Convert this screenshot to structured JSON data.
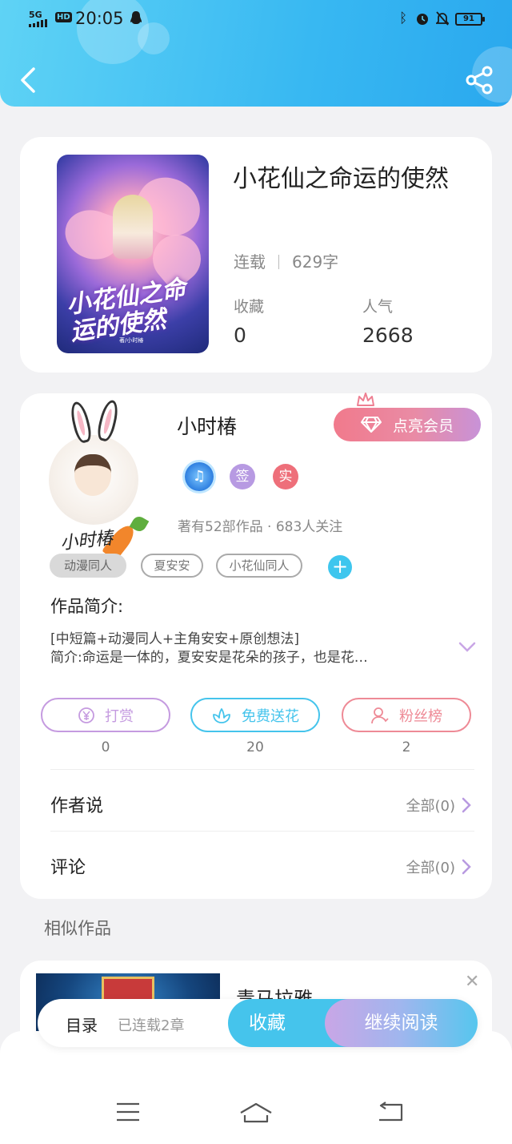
{
  "status_bar": {
    "network": "5G",
    "hd": "HD",
    "time": "20:05",
    "battery": "91"
  },
  "icons": {
    "back": "chevron-left-icon",
    "share": "share-icon"
  },
  "book": {
    "title": "小花仙之命运的使然",
    "status": "连载",
    "word_count": "629字",
    "favorites_label": "收藏",
    "favorites_value": "0",
    "popularity_label": "人气",
    "popularity_value": "2668",
    "cover_title": "小花仙之命运的使然",
    "cover_author": "著/小时椿"
  },
  "author": {
    "name": "小时椿",
    "vip_label": "点亮会员",
    "badges": [
      "签",
      "实"
    ],
    "works_info": "著有52部作品 · 683人关注",
    "signature": "小时椿"
  },
  "tags": [
    "动漫同人",
    "夏安安",
    "小花仙同人"
  ],
  "intro": {
    "label": "作品简介:",
    "line1": "[中短篇+动漫同人+主角安安+原创想法]",
    "line2": "简介:命运是一体的，夏安安是花朵的孩子，也是花…"
  },
  "actions": [
    {
      "label": "打赏",
      "count": "0",
      "color": "#c59be0"
    },
    {
      "label": "免费送花",
      "count": "20",
      "color": "#45c4ec"
    },
    {
      "label": "粉丝榜",
      "count": "2",
      "color": "#ee8a96"
    }
  ],
  "author_say": {
    "label": "作者说",
    "right": "全部(0)"
  },
  "comments": {
    "label": "评论",
    "right": "全部(0)"
  },
  "similar": {
    "label": "相似作品",
    "title": "青马拉雅"
  },
  "bottom_bar": {
    "toc": "目录",
    "toc_sub": "已连载2章",
    "favorite": "收藏",
    "read": "继续阅读"
  }
}
